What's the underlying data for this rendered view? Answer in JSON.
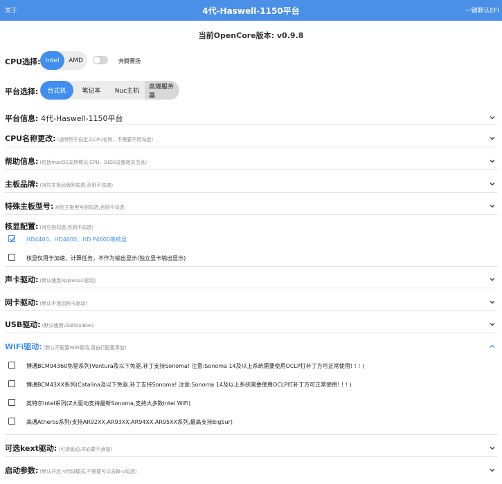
{
  "header": {
    "about": "关于",
    "title": "4代-Haswell-1150平台",
    "one_click": "一键默认EFI"
  },
  "version_text": "当前OpenCore版本: v0.9.8",
  "cpu": {
    "label": "CPU选择:",
    "options": [
      "Intel",
      "AMD"
    ],
    "selected": "Intel",
    "toggle_label": "奔腾赛扬",
    "toggle_on": false
  },
  "platform": {
    "label": "平台选择:",
    "options": [
      "台式机",
      "笔记本",
      "Nuc主机",
      "高端服务器"
    ],
    "selected": "台式机"
  },
  "platform_info": {
    "label": "平台信息:",
    "value": "4代-Haswell-1150平台"
  },
  "sections": {
    "cpu_name": {
      "title": "CPU名称更改:",
      "hint": "(通常用于自定义CPU名称，不需要不用勾选)"
    },
    "help": {
      "title": "帮助信息:",
      "hint": "(包括macOS支持情况,CPU、BIOS设置相关信息)"
    },
    "board_brand": {
      "title": "主板品牌:",
      "hint": "(对应主板品牌则勾选,否则不勾选)"
    },
    "special_board": {
      "title": "特殊主板型号:",
      "hint": "对应主板型号则勾选,否则不勾选"
    },
    "igpu": {
      "title": "核显配置:",
      "hint": "(对应则勾选,否则不勾选)"
    },
    "audio": {
      "title": "声卡驱动:",
      "hint": "(默认使用AppleALC驱动)"
    },
    "network": {
      "title": "网卡驱动:",
      "hint": "(默认不添加网卡驱动)"
    },
    "usb": {
      "title": "USB驱动:",
      "hint": "(默认使用USBToolBox)"
    },
    "wifi": {
      "title": "WiFi驱动:",
      "hint": "(默认不配置WiFi驱动,请自行配置添加)"
    },
    "kext": {
      "title": "可选kext驱动:",
      "hint": "(可选驱动,非必要不添加)"
    },
    "boot_args": {
      "title": "启动参数:",
      "hint": "(默认开启-v代码模式,不需要可以去掉-v勾选)"
    }
  },
  "igpu_options": [
    {
      "label": "HD4400、HD4600、HD P4600等核显",
      "checked": true
    },
    {
      "label": "核显仅用于加速、计算任务，不作为输出显示(独立显卡输出显示)",
      "checked": false
    }
  ],
  "wifi_options": [
    {
      "label": "博通BCM94360免驱系列(Ventura及以下免驱,补丁支持Sonoma! 注意:Sonoma 14及以上系统需要使用OCLP打补丁方可正常使用! ! ! )",
      "checked": false
    },
    {
      "label": "博通BCM43XX系列(Catalina及以下免驱,补丁支持Sonoma! 注意:Sonoma 14及以上系统需要使用OCLP打补丁方可正常使用! ! ! )",
      "checked": false
    },
    {
      "label": "英特尔Intel系列(Z大驱动支持最新Sonoma,支持大多数Intel WiFi)",
      "checked": false
    },
    {
      "label": "高通Atheros系列(支持AR92XX,AR93XX,AR94XX,AR95XX系列,最高支持BigSur)",
      "checked": false
    }
  ],
  "colors": {
    "accent": "#4a8fe8",
    "active": "#3f8ef0"
  }
}
